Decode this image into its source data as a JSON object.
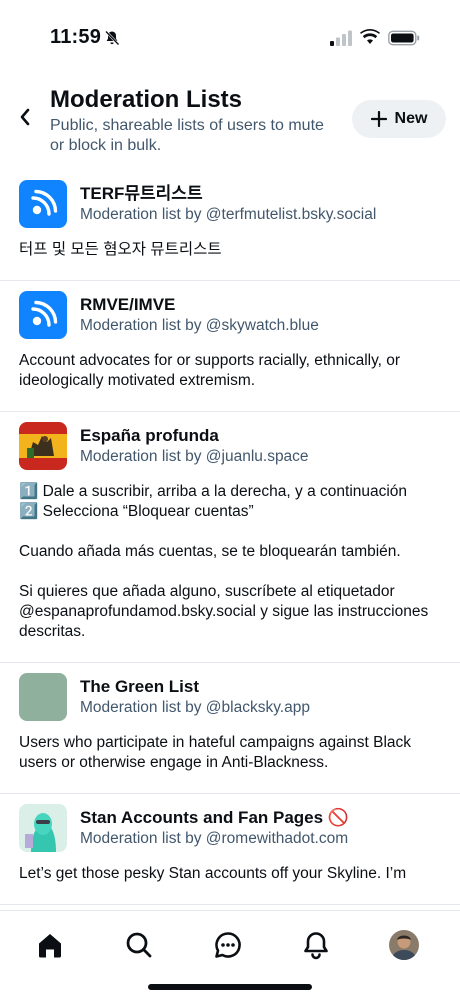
{
  "status": {
    "time": "11:59"
  },
  "header": {
    "title": "Moderation Lists",
    "subtitle": "Public, shareable lists of users to mute or block in bulk.",
    "new_button_label": "New"
  },
  "lists": [
    {
      "name": "TERF뮤트리스트",
      "byline": "Moderation list by @terfmutelist.bsky.social",
      "description": "터프 및 모든 혐오자 뮤트리스트",
      "avatar": "default-list-icon"
    },
    {
      "name": "RMVE/IMVE",
      "byline": "Moderation list by @skywatch.blue",
      "description": "Account advocates for or supports racially, ethnically, or ideologically motivated extremism.",
      "avatar": "default-list-icon"
    },
    {
      "name": "España profunda",
      "byline": "Moderation list by @juanlu.space",
      "description": "1️⃣ Dale a suscribir, arriba a la derecha, y a continuación\n2️⃣ Selecciona “Bloquear cuentas”\n\nCuando añada más cuentas, se te bloquearán también.\n\nSi quieres que añada alguno, suscríbete al etiquetador @espanaprofundamod.bsky.social y sigue las instrucciones descritas.",
      "avatar": "spain-flag-image"
    },
    {
      "name": "The Green List",
      "byline": "Moderation list by @blacksky.app",
      "description": "Users who participate in hateful campaigns against Black users or otherwise engage in Anti-Blackness.",
      "avatar": "green-square"
    },
    {
      "name": "Stan Accounts and Fan Pages 🚫",
      "byline": "Moderation list by @romewithadot.com",
      "description": "Let’s get those pesky Stan accounts off your Skyline. I’m",
      "avatar": "photo"
    }
  ],
  "tabs": [
    "home",
    "search",
    "chat",
    "notifications",
    "profile"
  ],
  "colors": {
    "accent": "#1083fe",
    "muted_text": "#42576c",
    "pill_bg": "#eef1f4"
  }
}
